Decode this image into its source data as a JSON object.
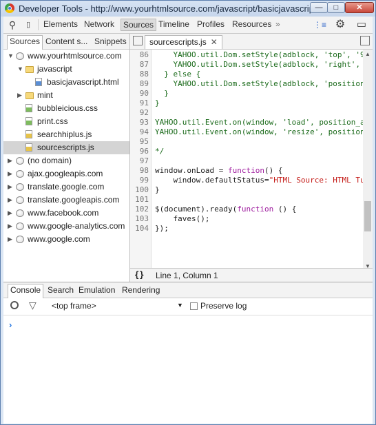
{
  "window": {
    "title": "Developer Tools - http://www.yourhtmlsource.com/javascript/basicjavascript....",
    "minimize_label": "—",
    "maximize_label": "□",
    "close_label": "✕"
  },
  "toolbar": {
    "search_icon": "⚲",
    "tabs": [
      "Elements",
      "Network",
      "Sources",
      "Timeline",
      "Profiles",
      "Resources"
    ],
    "active_tab": "Sources",
    "more": "»",
    "console_icon": "⋮≡",
    "settings_icon": "⚙",
    "dock_icon": "▭"
  },
  "navigator": {
    "tabs": [
      "Sources",
      "Content s...",
      "Snippets"
    ],
    "active_tab": "Sources",
    "tree": [
      {
        "label": "www.yourhtmlsource.com",
        "type": "globe",
        "level": 0,
        "expanded": true
      },
      {
        "label": "javascript",
        "type": "folder",
        "level": 1,
        "expanded": true
      },
      {
        "label": "basicjavascript.html",
        "type": "html",
        "level": 2
      },
      {
        "label": "mint",
        "type": "folder",
        "level": 1,
        "expanded": false
      },
      {
        "label": "bubbleicious.css",
        "type": "css",
        "level": 1
      },
      {
        "label": "print.css",
        "type": "css",
        "level": 1
      },
      {
        "label": "searchhiplus.js",
        "type": "js",
        "level": 1
      },
      {
        "label": "sourcescripts.js",
        "type": "js",
        "level": 1,
        "selected": true
      },
      {
        "label": "(no domain)",
        "type": "globe",
        "level": 0,
        "expanded": false
      },
      {
        "label": "ajax.googleapis.com",
        "type": "globe",
        "level": 0,
        "expanded": false
      },
      {
        "label": "translate.google.com",
        "type": "globe",
        "level": 0,
        "expanded": false
      },
      {
        "label": "translate.googleapis.com",
        "type": "globe",
        "level": 0,
        "expanded": false
      },
      {
        "label": "www.facebook.com",
        "type": "globe",
        "level": 0,
        "expanded": false
      },
      {
        "label": "www.google-analytics.com",
        "type": "globe",
        "level": 0,
        "expanded": false
      },
      {
        "label": "www.google.com",
        "type": "globe",
        "level": 0,
        "expanded": false
      }
    ]
  },
  "editor": {
    "tab_label": "sourcescripts.js",
    "tab_close": "✕",
    "lines": [
      {
        "n": "86",
        "text": "    YAHOO.util.Dom.setStyle(adblock, 'top', '9",
        "style": "comment"
      },
      {
        "n": "87",
        "text": "    YAHOO.util.Dom.setStyle(adblock, 'right', ",
        "style": "comment"
      },
      {
        "n": "88",
        "text": "  } else {",
        "style": "comment"
      },
      {
        "n": "89",
        "text": "    YAHOO.util.Dom.setStyle(adblock, 'position",
        "style": "comment"
      },
      {
        "n": "90",
        "text": "  }",
        "style": "comment"
      },
      {
        "n": "91",
        "text": "}",
        "style": "comment"
      },
      {
        "n": "92",
        "text": "",
        "style": "comment"
      },
      {
        "n": "93",
        "text": "YAHOO.util.Event.on(window, 'load', position_a",
        "style": "comment"
      },
      {
        "n": "94",
        "text": "YAHOO.util.Event.on(window, 'resize', position",
        "style": "comment"
      },
      {
        "n": "95",
        "text": "",
        "style": "comment"
      },
      {
        "n": "96",
        "text": "*/",
        "style": "comment"
      },
      {
        "n": "97",
        "text": "",
        "style": "plain"
      },
      {
        "n": "98",
        "text": "window.onLoad = ",
        "kw": "function",
        "rest": "() {",
        "style": "plain"
      },
      {
        "n": "99",
        "text": "    window.defaultStatus=",
        "str": "\"HTML Source: HTML Tu",
        "style": "plain"
      },
      {
        "n": "100",
        "text": "}",
        "style": "plain"
      },
      {
        "n": "101",
        "text": "",
        "style": "plain"
      },
      {
        "n": "102",
        "text": "$(document).ready(",
        "kw": "function",
        "rest": " () {",
        "style": "plain"
      },
      {
        "n": "103",
        "text": "    faves();",
        "style": "plain"
      },
      {
        "n": "104",
        "text": "});",
        "style": "plain"
      }
    ]
  },
  "status": {
    "format_icon": "{}",
    "position": "Line 1, Column 1"
  },
  "drawer": {
    "tabs": [
      "Console",
      "Search",
      "Emulation",
      "Rendering"
    ],
    "active_tab": "Console",
    "clear_icon": "⃠",
    "filter_icon": "▽",
    "frame": "<top frame>",
    "frame_arrow": "▼",
    "preserve_log": "Preserve log",
    "prompt": "›"
  }
}
